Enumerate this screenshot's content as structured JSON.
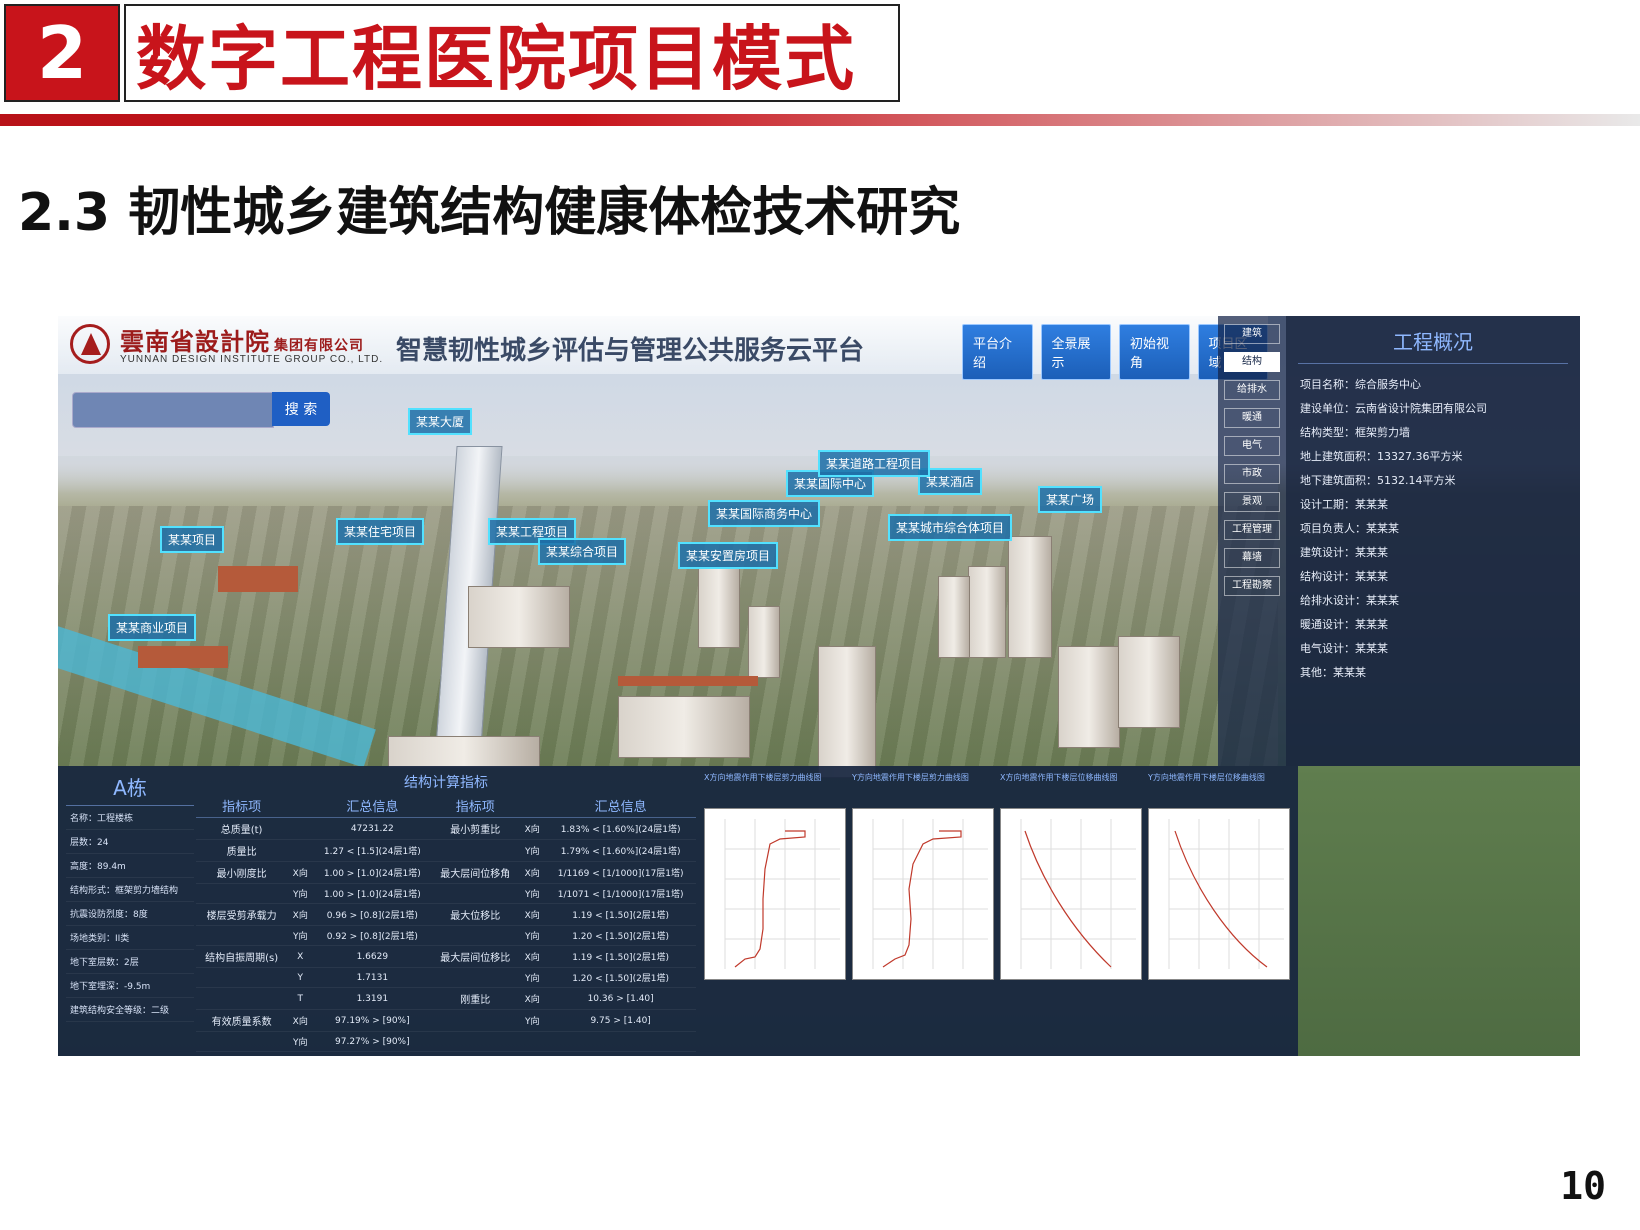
{
  "slide": {
    "section_number": "2",
    "section_title": "数字工程医院项目模式",
    "subtitle": "2.3 韧性城乡建筑结构健康体检技术研究",
    "page_number": "10"
  },
  "app": {
    "org_name_cn": "雲南省設計院",
    "org_suffix_cn": "集团有限公司",
    "org_name_en": "YUNNAN DESIGN INSTITUTE GROUP CO., LTD.",
    "platform_title": "智慧韧性城乡评估与管理公共服务云平台",
    "nav_buttons": [
      "平台介绍",
      "全景展示",
      "初始视角",
      "项目区域"
    ],
    "search": {
      "placeholder": "",
      "button_label": "搜 索"
    },
    "map_labels": [
      "某某大厦",
      "某某项目",
      "某某商业项目",
      "某某国际中心",
      "某某酒店",
      "某某广场",
      "某某住宅项目",
      "某某国际商务中心",
      "某某工程项目",
      "某某综合项目",
      "某某安置房项目",
      "某某城市综合体项目",
      "某某道路工程项目"
    ],
    "right_nav": [
      "建筑",
      "结构",
      "给排水",
      "暖通",
      "电气",
      "市政",
      "景观",
      "工程管理",
      "幕墙",
      "工程勘察"
    ],
    "right_nav_active": 1,
    "overview": {
      "title": "工程概况",
      "rows": [
        "项目名称：综合服务中心",
        "建设单位：云南省设计院集团有限公司",
        "结构类型：框架剪力墙",
        "地上建筑面积：13327.36平方米",
        "地下建筑面积：5132.14平方米",
        "设计工期：某某某",
        "项目负责人：某某某",
        "建筑设计：某某某",
        "结构设计：某某某",
        "给排水设计：某某某",
        "暖通设计：某某某",
        "电气设计：某某某",
        "其他：某某某"
      ]
    },
    "building_panel": {
      "title": "A栋",
      "rows": [
        "名称：工程楼栋",
        "层数：24",
        "高度：89.4m",
        "结构形式：框架剪力墙结构",
        "抗震设防烈度：8度",
        "场地类别：II类",
        "地下室层数：2层",
        "地下室埋深：-9.5m",
        "建筑结构安全等级：二级"
      ]
    },
    "calc_table": {
      "title": "结构计算指标",
      "headers": [
        "指标项",
        "汇总信息",
        "指标项",
        "汇总信息"
      ],
      "left_rows": [
        {
          "label": "总质量(t)",
          "dir": "",
          "value": "47231.22"
        },
        {
          "label": "质量比",
          "dir": "",
          "value": "1.27 < [1.5](24层1塔)"
        },
        {
          "label": "最小刚度比",
          "dir": "X向",
          "value": "1.00 > [1.0](24层1塔)"
        },
        {
          "label": "",
          "dir": "Y向",
          "value": "1.00 > [1.0](24层1塔)"
        },
        {
          "label": "楼层受剪承载力",
          "dir": "X向",
          "value": "0.96 > [0.8](2层1塔)"
        },
        {
          "label": "",
          "dir": "Y向",
          "value": "0.92 > [0.8](2层1塔)"
        },
        {
          "label": "结构自振周期(s)",
          "dir": "X",
          "value": "1.6629"
        },
        {
          "label": "",
          "dir": "Y",
          "value": "1.7131"
        },
        {
          "label": "",
          "dir": "T",
          "value": "1.3191"
        },
        {
          "label": "有效质量系数",
          "dir": "X向",
          "value": "97.19% > [90%]"
        },
        {
          "label": "",
          "dir": "Y向",
          "value": "97.27% > [90%]"
        }
      ],
      "right_rows": [
        {
          "label": "最小剪重比",
          "dir": "X向",
          "value": "1.83% < [1.60%](24层1塔)"
        },
        {
          "label": "",
          "dir": "Y向",
          "value": "1.79% < [1.60%](24层1塔)"
        },
        {
          "label": "最大层间位移角",
          "dir": "X向",
          "value": "1/1169 < [1/1000](17层1塔)"
        },
        {
          "label": "",
          "dir": "Y向",
          "value": "1/1071 < [1/1000](17层1塔)"
        },
        {
          "label": "最大位移比",
          "dir": "X向",
          "value": "1.19 < [1.50](2层1塔)"
        },
        {
          "label": "",
          "dir": "Y向",
          "value": "1.20 < [1.50](2层1塔)"
        },
        {
          "label": "最大层间位移比",
          "dir": "X向",
          "value": "1.19 < [1.50](2层1塔)"
        },
        {
          "label": "",
          "dir": "Y向",
          "value": "1.20 < [1.50](2层1塔)"
        },
        {
          "label": "刚重比",
          "dir": "X向",
          "value": "10.36 > [1.40]"
        },
        {
          "label": "",
          "dir": "Y向",
          "value": "9.75 > [1.40]"
        }
      ]
    },
    "chart_titles": [
      "X方向地震作用下楼层剪力曲线图",
      "Y方向地震作用下楼层剪力曲线图",
      "X方向地震作用下楼层位移曲线图",
      "Y方向地震作用下楼层位移曲线图"
    ],
    "colors": {
      "section_red": "#c8141b",
      "panel_bg": "#18263f",
      "accent_blue": "#8fb8ff",
      "label_border": "#52e1ff",
      "curve_red": "#c0392b"
    }
  }
}
